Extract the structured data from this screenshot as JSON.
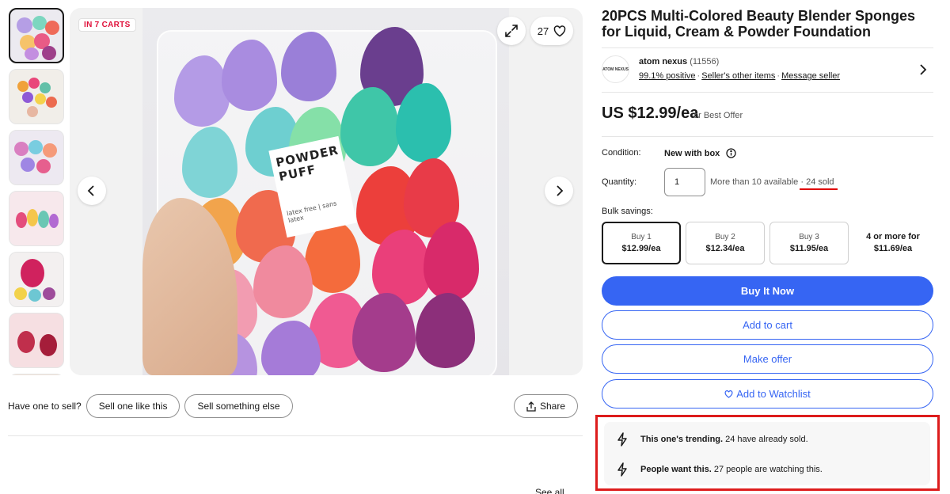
{
  "gallery": {
    "cart_badge": "IN 7 CARTS",
    "watch_count": "27",
    "photo_label_title": "POWDER PUFF",
    "photo_label_sub": "latex free | sans latex"
  },
  "sell": {
    "question": "Have one to sell?",
    "sell_like_label": "Sell one like this",
    "sell_else_label": "Sell something else",
    "share_label": "Share"
  },
  "see_all": "See all",
  "product": {
    "title": "20PCS Multi-Colored Beauty Blender Sponges for Liquid, Cream & Powder Foundation"
  },
  "seller": {
    "logo_text": "ATOM NEXUS",
    "name": "atom nexus",
    "feedback_count": "(11556)",
    "positive": "99.1% positive",
    "other_items": "Seller's other items",
    "message": "Message seller"
  },
  "price": {
    "value": "US $12.99/ea",
    "best_offer": "or Best Offer"
  },
  "condition": {
    "label": "Condition:",
    "value": "New with box"
  },
  "quantity": {
    "label": "Quantity:",
    "value": "1",
    "available": "More than 10 available",
    "sold": "24 sold"
  },
  "bulk": {
    "label": "Bulk savings:",
    "options": [
      {
        "qty": "Buy 1",
        "price": "$12.99/ea"
      },
      {
        "qty": "Buy 2",
        "price": "$12.34/ea"
      },
      {
        "qty": "Buy 3",
        "price": "$11.95/ea"
      },
      {
        "qty": "4 or more for",
        "price": "$11.69/ea"
      }
    ]
  },
  "actions": {
    "buy_now": "Buy It Now",
    "add_cart": "Add to cart",
    "make_offer": "Make offer",
    "watchlist": "Add to Watchlist"
  },
  "trending": [
    {
      "bold": "This one's trending.",
      "text": "24 have already sold."
    },
    {
      "bold": "People want this.",
      "text": "27 people are watching this."
    }
  ],
  "colors": {
    "primary": "#3665f3",
    "highlight": "#dd1c1c",
    "cart_badge": "#e0103a"
  }
}
